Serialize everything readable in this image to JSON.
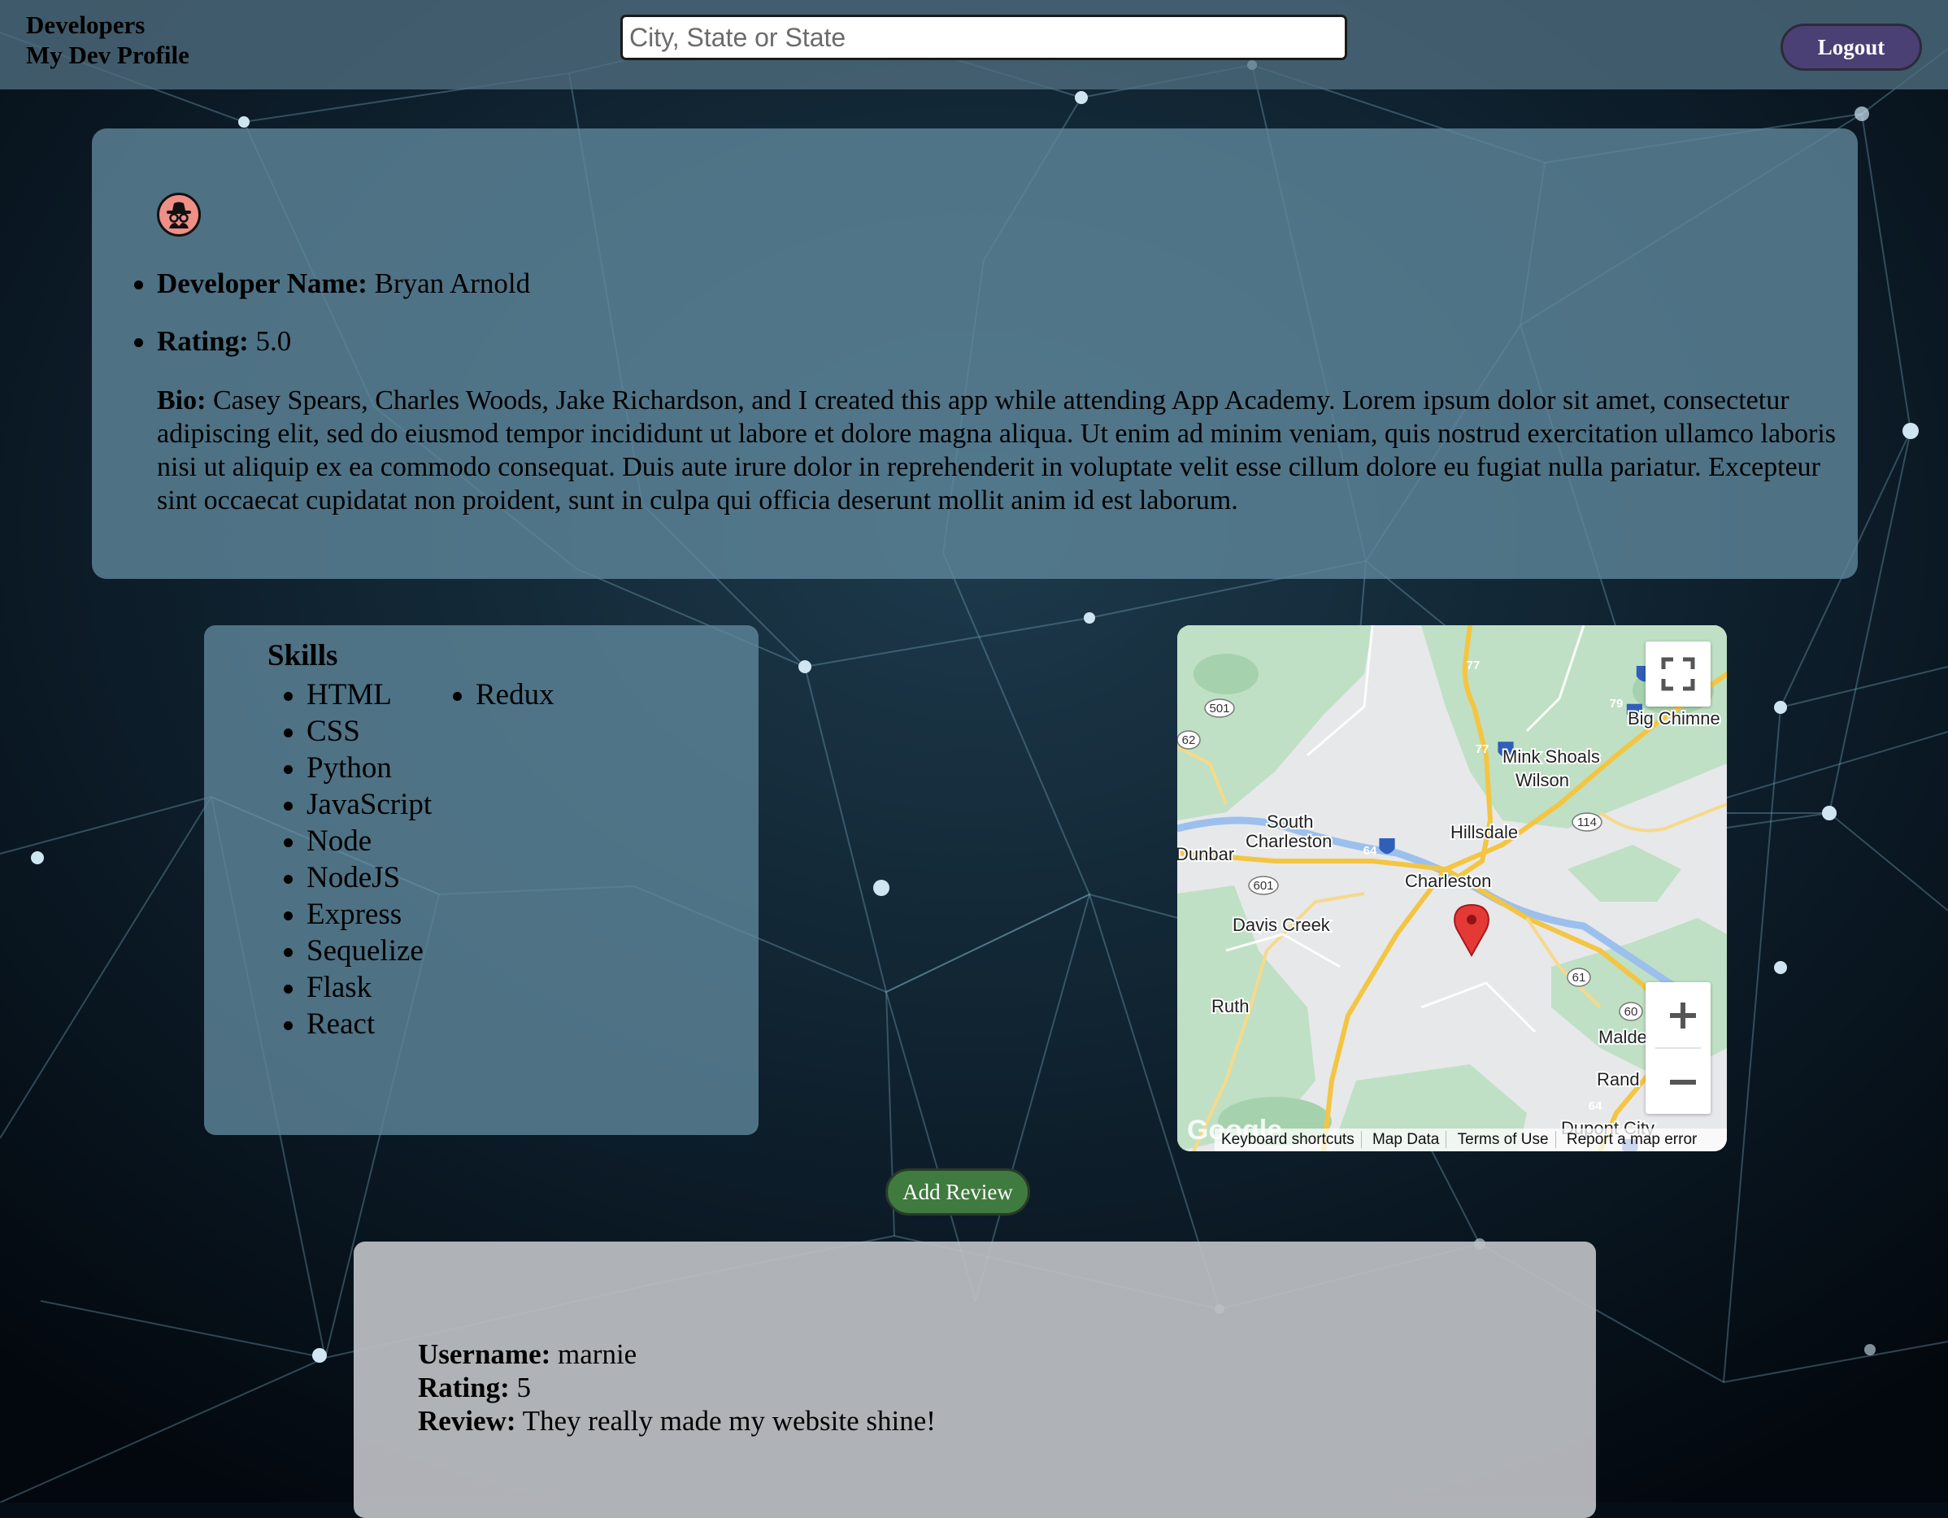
{
  "header": {
    "nav": [
      "Developers",
      "My Dev Profile"
    ],
    "search_placeholder": "City, State or State",
    "logout_label": "Logout"
  },
  "profile": {
    "avatar_icon": "incognito-spy-icon",
    "name_label": "Developer Name:",
    "name": "Bryan Arnold",
    "rating_label": "Rating:",
    "rating": "5.0",
    "bio_label": "Bio:",
    "bio": "Casey Spears, Charles Woods, Jake Richardson, and I created this app while attending App Academy. Lorem ipsum dolor sit amet, consectetur adipiscing elit, sed do eiusmod tempor incididunt ut labore et dolore magna aliqua. Ut enim ad minim veniam, quis nostrud exercitation ullamco laboris nisi ut aliquip ex ea commodo consequat. Duis aute irure dolor in reprehenderit in voluptate velit esse cillum dolore eu fugiat nulla pariatur. Excepteur sint occaecat cupidatat non proident, sunt in culpa qui officia deserunt mollit anim id est laborum."
  },
  "skills": {
    "title": "Skills",
    "items": [
      "HTML",
      "CSS",
      "Python",
      "JavaScript",
      "Node",
      "NodeJS",
      "Express",
      "Sequelize",
      "Flask",
      "React",
      "Redux"
    ]
  },
  "map": {
    "places": [
      "Big Chimne",
      "Mink Shoals",
      "Wilson",
      "South",
      "Charleston",
      "Hillsdale",
      "Dunbar",
      "Charleston",
      "Davis Creek",
      "Ruth",
      "Malde",
      "Rand",
      "Dupont City"
    ],
    "route_shields": [
      "77",
      "79",
      "77",
      "501",
      "62",
      "114",
      "64",
      "601",
      "61",
      "60",
      "64"
    ],
    "footer": [
      "Keyboard shortcuts",
      "Map Data",
      "Terms of Use",
      "Report a map error"
    ],
    "attribution": "Google",
    "zoom_in_icon": "plus-icon",
    "zoom_out_icon": "minus-icon",
    "fullscreen_icon": "fullscreen-icon",
    "marker_icon": "map-pin-icon",
    "marker_color": "#e53935"
  },
  "actions": {
    "add_review_label": "Add Review"
  },
  "reviews": [
    {
      "username_label": "Username:",
      "username": "marnie",
      "rating_label": "Rating:",
      "rating": "5",
      "review_label": "Review:",
      "review": "They really made my website shine!"
    }
  ],
  "colors": {
    "header_bg": "#506e80",
    "card_bg": "#5f879b",
    "logout_bg": "#4b4074",
    "add_review_bg": "#3f7a3f",
    "review_card_bg": "#bec0c4"
  }
}
